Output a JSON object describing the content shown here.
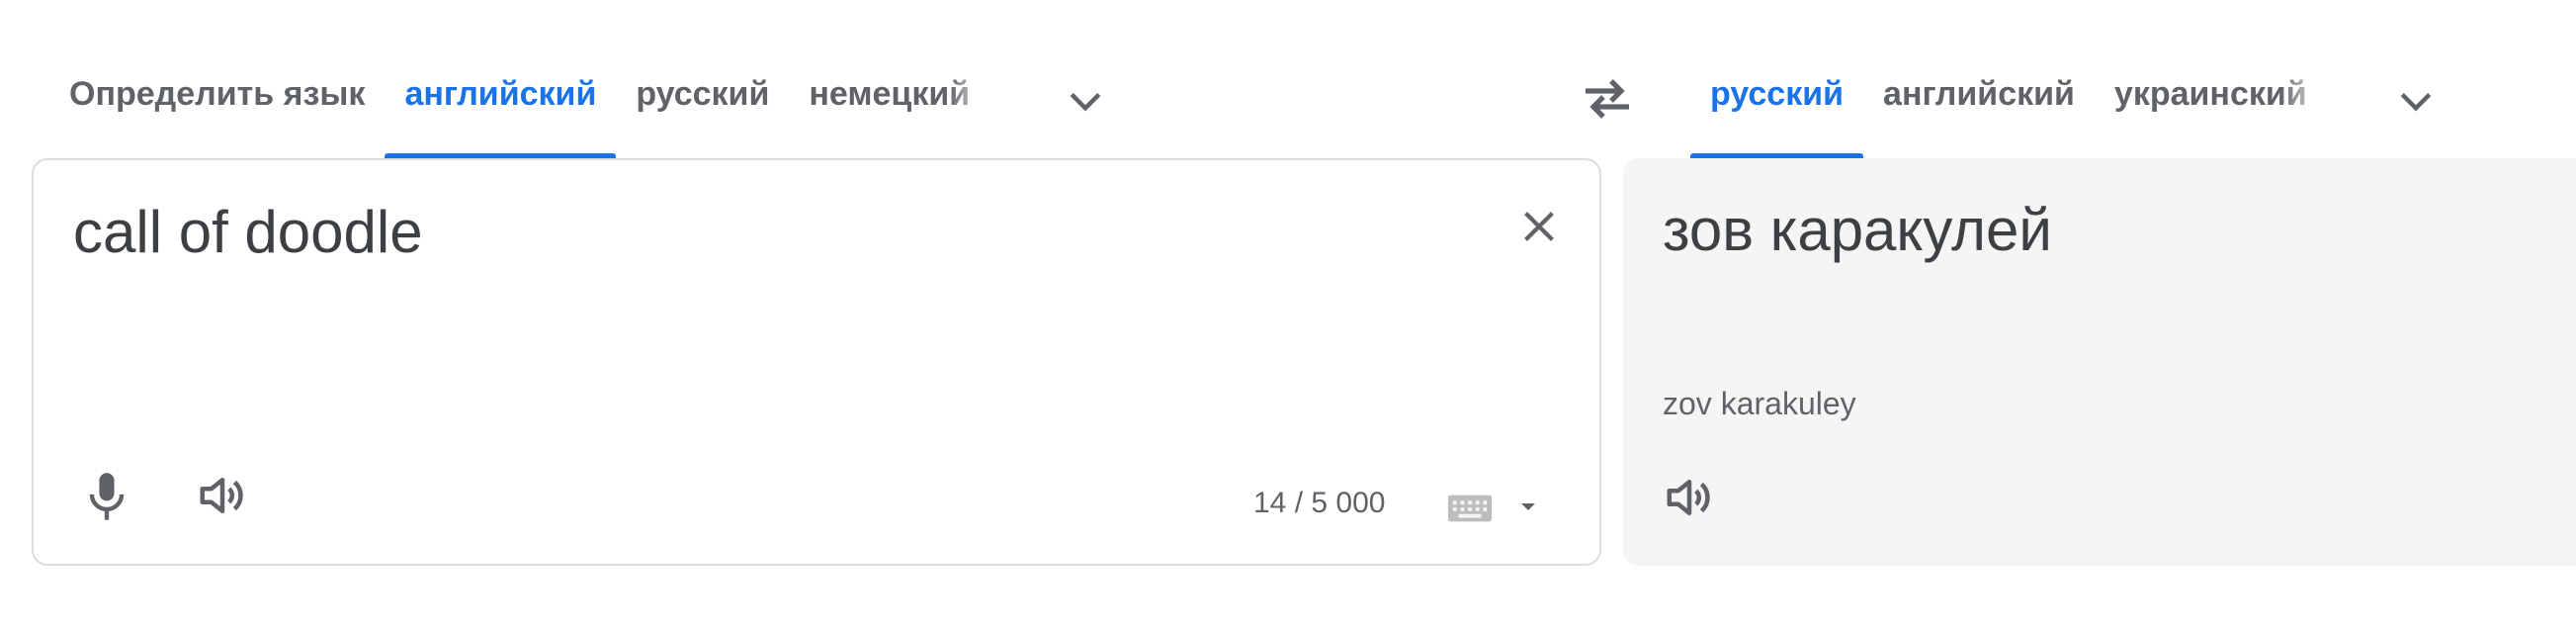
{
  "source_languages": {
    "tabs": [
      {
        "label": "Определить язык",
        "active": false
      },
      {
        "label": "английский",
        "active": true
      },
      {
        "label": "русский",
        "active": false
      },
      {
        "label": "немецкий",
        "active": false
      }
    ],
    "more_icon": "chevron-down-icon"
  },
  "swap_icon": "swap-arrows-icon",
  "target_languages": {
    "tabs": [
      {
        "label": "русский",
        "active": true
      },
      {
        "label": "английский",
        "active": false
      },
      {
        "label": "украинский",
        "active": false
      }
    ],
    "more_icon": "chevron-down-icon"
  },
  "source_panel": {
    "text": "call of doodle",
    "char_count": "14 / 5 000",
    "icons": [
      "close-icon",
      "microphone-icon",
      "speaker-icon",
      "keyboard-icon",
      "dropdown-arrow-icon"
    ]
  },
  "target_panel": {
    "text": "зов каракулей",
    "transliteration": "zov karakuley",
    "icons": [
      "speaker-icon"
    ]
  },
  "colors": {
    "accent": "#1a73e8",
    "text": "#3c4043",
    "muted": "#5f6368",
    "target_bg": "#f5f5f5",
    "border": "#dadce0"
  }
}
